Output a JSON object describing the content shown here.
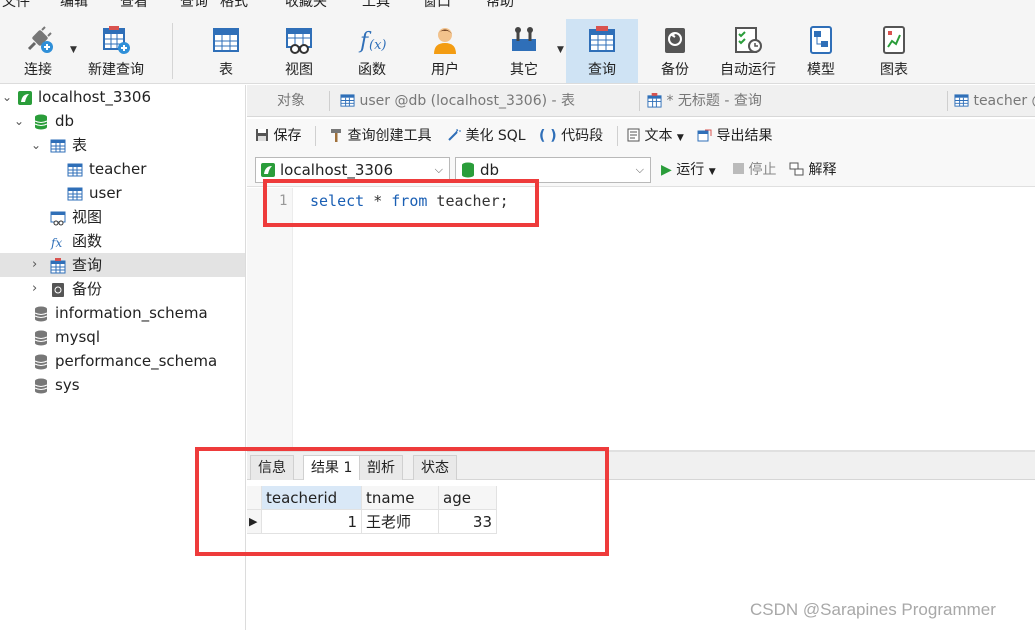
{
  "menu": {
    "items": [
      "文件",
      "编辑",
      "查看",
      "查询",
      "格式",
      "收藏夹",
      "工具",
      "窗口",
      "帮助"
    ]
  },
  "toolbar": {
    "connect": "连接",
    "new_query": "新建查询",
    "table": "表",
    "view": "视图",
    "function": "函数",
    "user": "用户",
    "other": "其它",
    "query": "查询",
    "backup": "备份",
    "auto_run": "自动运行",
    "model": "模型",
    "chart": "图表"
  },
  "tree": {
    "connection": "localhost_3306",
    "database": "db",
    "tables_folder": "表",
    "tables": [
      "teacher",
      "user"
    ],
    "views_folder": "视图",
    "functions_folder": "函数",
    "queries_folder": "查询",
    "backups_folder": "备份",
    "other_dbs": [
      "information_schema",
      "mysql",
      "performance_schema",
      "sys"
    ]
  },
  "tabs": {
    "objects": "对象",
    "tab1": "user @db (localhost_3306) - 表",
    "tab2": "* 无标题 - 查询",
    "tab3": "teacher @"
  },
  "query_toolbar": {
    "save": "保存",
    "builder": "查询创建工具",
    "beautify": "美化 SQL",
    "snippet": "代码段",
    "text": "文本",
    "export": "导出结果",
    "run": "运行",
    "stop": "停止",
    "explain": "解释"
  },
  "connection_select": "localhost_3306",
  "database_select": "db",
  "editor": {
    "line_number": "1",
    "kw_select": "select",
    "star": " * ",
    "kw_from": "from",
    "rest": " teacher;"
  },
  "result_tabs": [
    "信息",
    "结果 1",
    "剖析",
    "状态"
  ],
  "result": {
    "columns": [
      "teacherid",
      "tname",
      "age"
    ],
    "row": [
      "1",
      "王老师",
      "33"
    ]
  },
  "watermark": "CSDN @Sarapines Programmer",
  "colors": {
    "highlight_box": "#ee3b3b",
    "active_tool": "#cfe3f4",
    "keyword": "#1a5fb4"
  }
}
